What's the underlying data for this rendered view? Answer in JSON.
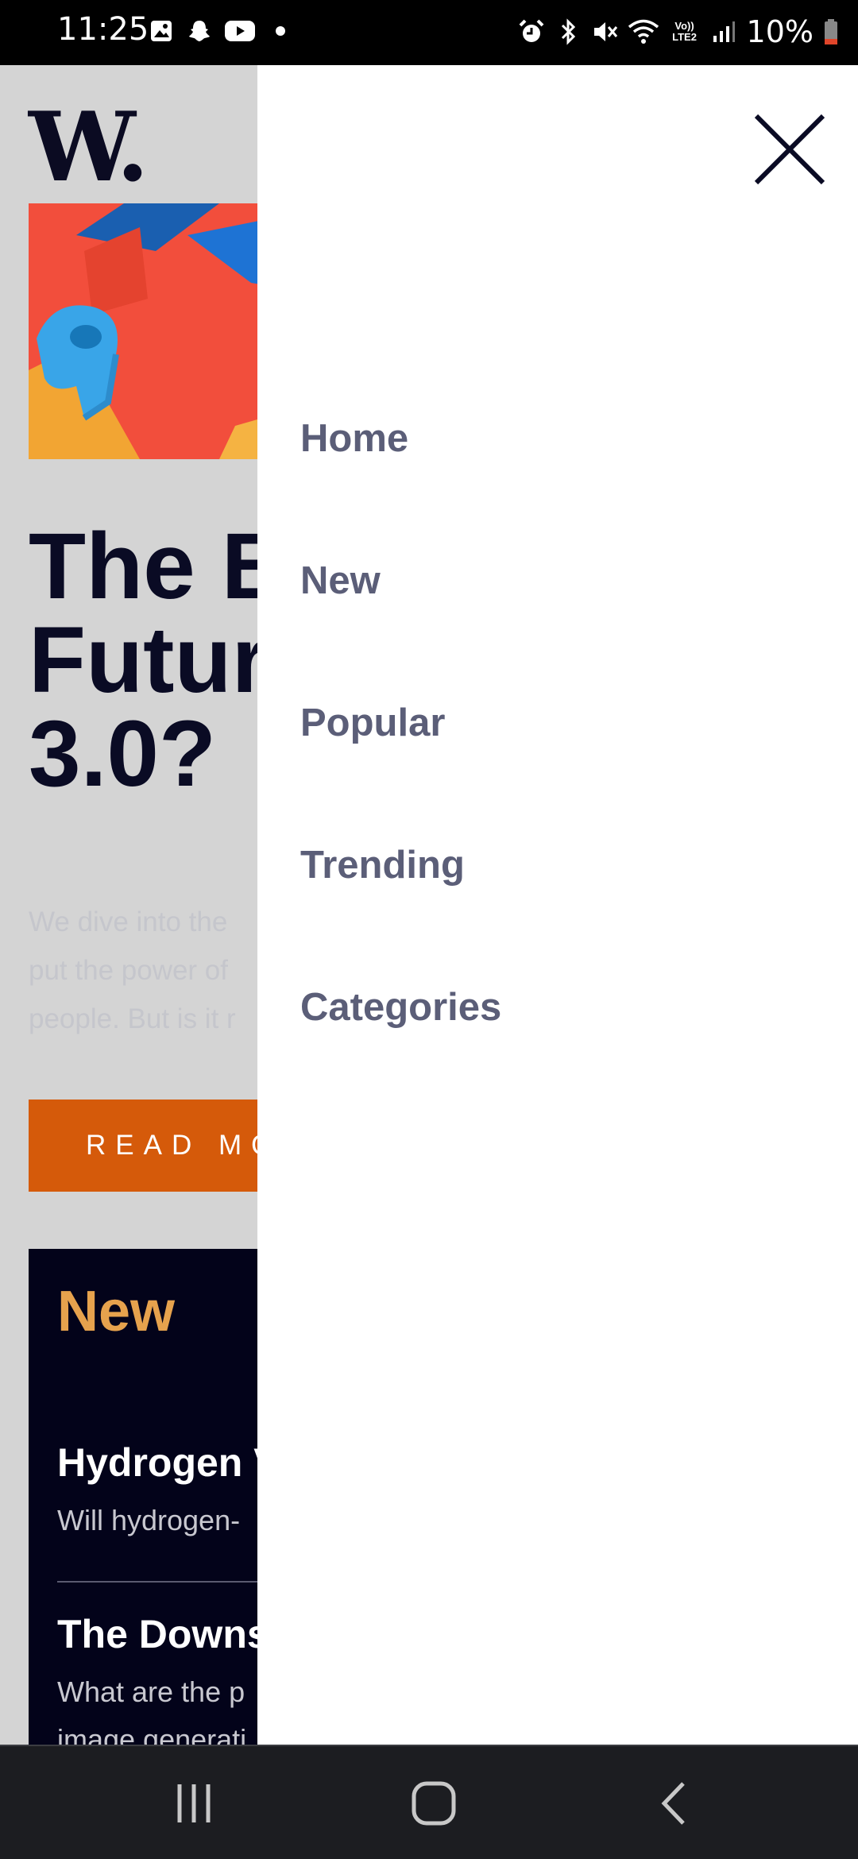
{
  "status_bar": {
    "time": "11:25",
    "battery": "10%",
    "left_icons": [
      "gallery-icon",
      "snapchat-icon",
      "youtube-icon",
      "dot-icon"
    ],
    "right_icons": [
      "alarm-icon",
      "bluetooth-icon",
      "mute-icon",
      "wifi-icon",
      "volte-icon",
      "signal-icon",
      "battery-icon"
    ],
    "volte_label": "Vo)) LTE2"
  },
  "page": {
    "logo": "W.",
    "headline_lines": [
      "The B",
      "Futur",
      "3.0?"
    ],
    "excerpt_lines": [
      "We dive into the",
      "put the power of",
      "people. But is it r"
    ],
    "read_more_label": "READ MO",
    "new_section": {
      "title": "New",
      "articles": [
        {
          "title": "Hydrogen V",
          "desc_lines": [
            "Will hydrogen-"
          ]
        },
        {
          "title": "The Downs",
          "desc_lines": [
            "What are the p",
            "image generati"
          ]
        }
      ]
    }
  },
  "drawer": {
    "close_icon": "close-icon",
    "menu_items": [
      "Home",
      "New",
      "Popular",
      "Trending",
      "Categories"
    ]
  },
  "nav_bar": {
    "buttons": [
      "recents-icon",
      "home-icon",
      "back-icon"
    ]
  },
  "colors": {
    "accent_orange": "#d55a0a",
    "new_heading": "#e6a24d",
    "headline": "#0a0b24",
    "menu_text": "#5b5e78",
    "page_overlay": "#d4d4d4"
  }
}
